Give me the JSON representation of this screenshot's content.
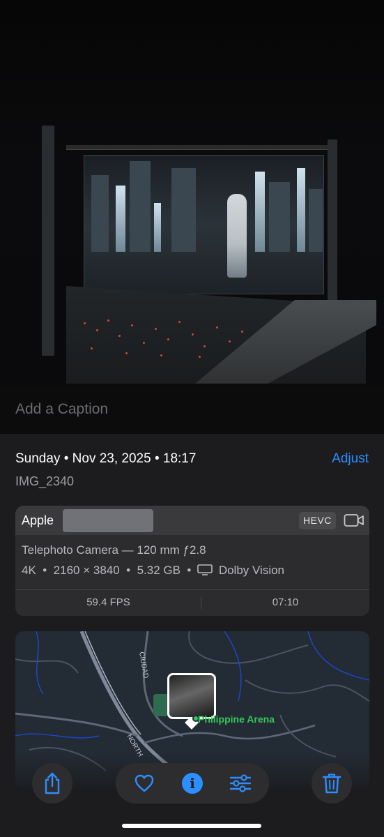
{
  "caption": {
    "placeholder": "Add a Caption"
  },
  "info": {
    "date_line": "Sunday • Nov 23, 2025 • 18:17",
    "adjust_label": "Adjust",
    "filename": "IMG_2340"
  },
  "camera": {
    "make": "Apple",
    "format_badge": "HEVC",
    "lens": "Telephoto Camera — 120 mm ƒ2.8",
    "resolution": "4K",
    "dimensions": "2160 × 3840",
    "size": "5.32 GB",
    "hdr": "Dolby Vision",
    "fps": "59.4 FPS",
    "duration": "07:10"
  },
  "map": {
    "place_name": "Philippine Arena"
  },
  "colors": {
    "accent": "#2c8eff",
    "sheet_bg": "#1c1c1e",
    "card_bg": "#2c2c2e",
    "place_green": "#37c659"
  },
  "toolbar": {
    "icons": [
      "share-icon",
      "heart-icon",
      "info-icon",
      "adjust-sliders-icon",
      "trash-icon"
    ]
  }
}
